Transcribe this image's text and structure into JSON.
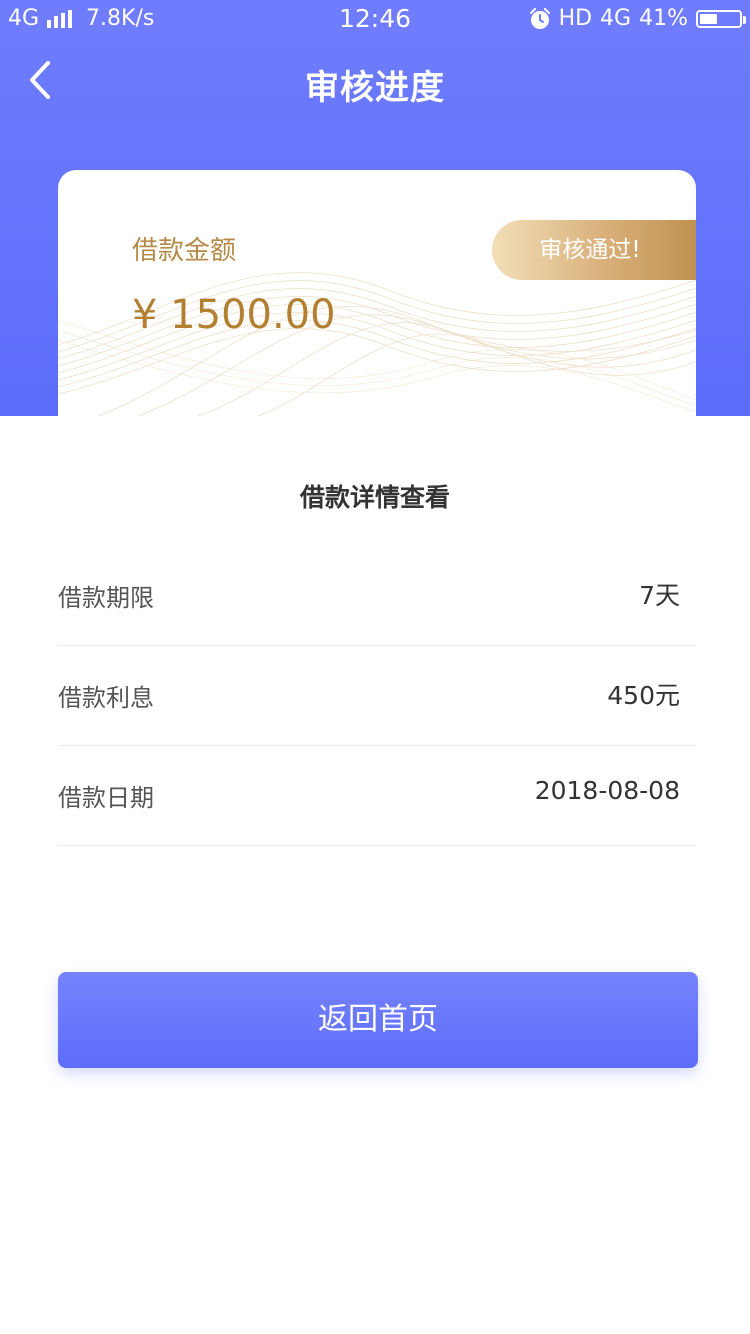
{
  "status_bar": {
    "network": "4G",
    "speed": "7.8K/s",
    "time": "12:46",
    "hd": "HD",
    "network_right": "4G",
    "battery": "41%"
  },
  "nav": {
    "title": "审核进度",
    "back_icon": "chevron-left-icon"
  },
  "card": {
    "label": "借款金额",
    "amount": "¥ 1500.00",
    "status": "审核通过!"
  },
  "details": {
    "title": "借款详情查看",
    "rows": [
      {
        "label": "借款期限",
        "value": "7天"
      },
      {
        "label": "借款利息",
        "value": "450元"
      },
      {
        "label": "借款日期",
        "value": "2018-08-08"
      }
    ]
  },
  "button": {
    "label": "返回首页"
  },
  "colors": {
    "primary": "#6272fb",
    "gold": "#b37f30"
  }
}
